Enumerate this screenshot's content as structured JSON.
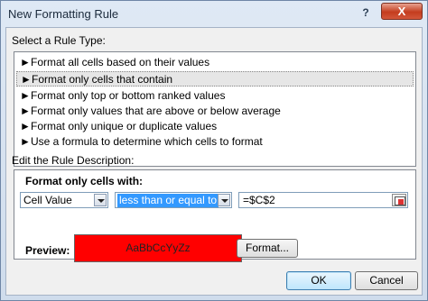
{
  "window": {
    "title": "New Formatting Rule",
    "help_glyph": "?",
    "close_glyph": "X"
  },
  "rule_type": {
    "label": "Select a Rule Type:",
    "items": [
      {
        "label": "Format all cells based on their values"
      },
      {
        "label": "Format only cells that contain",
        "selected": true
      },
      {
        "label": "Format only top or bottom ranked values"
      },
      {
        "label": "Format only values that are above or below average"
      },
      {
        "label": "Format only unique or duplicate values"
      },
      {
        "label": "Use a formula to determine which cells to format"
      }
    ],
    "bullet": "►"
  },
  "description": {
    "label": "Edit the Rule Description:",
    "heading": "Format only cells with:",
    "field_combo": "Cell Value",
    "operator_combo": "less than or equal to",
    "value_input": "=$C$2",
    "preview_label": "Preview:",
    "preview_text": "AaBbCcYyZz",
    "preview_color": "#ff0000",
    "format_button": "Format..."
  },
  "buttons": {
    "ok": "OK",
    "cancel": "Cancel"
  }
}
